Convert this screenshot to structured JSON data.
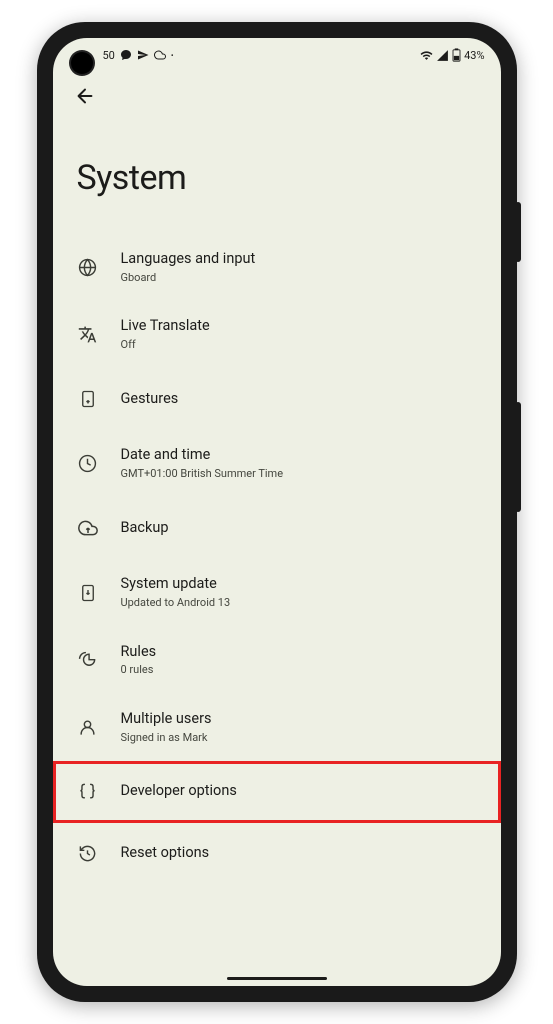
{
  "status_bar": {
    "time_fragment": "50",
    "battery_text": "43%"
  },
  "page": {
    "title": "System"
  },
  "items": [
    {
      "title": "Languages and input",
      "subtitle": "Gboard",
      "icon": "globe-icon"
    },
    {
      "title": "Live Translate",
      "subtitle": "Off",
      "icon": "translate-icon"
    },
    {
      "title": "Gestures",
      "subtitle": "",
      "icon": "gesture-icon"
    },
    {
      "title": "Date and time",
      "subtitle": "GMT+01:00 British Summer Time",
      "icon": "clock-icon"
    },
    {
      "title": "Backup",
      "subtitle": "",
      "icon": "cloud-icon"
    },
    {
      "title": "System update",
      "subtitle": "Updated to Android 13",
      "icon": "update-icon"
    },
    {
      "title": "Rules",
      "subtitle": "0 rules",
      "icon": "rules-icon"
    },
    {
      "title": "Multiple users",
      "subtitle": "Signed in as Mark",
      "icon": "person-icon"
    },
    {
      "title": "Developer options",
      "subtitle": "",
      "icon": "braces-icon",
      "highlighted": true
    },
    {
      "title": "Reset options",
      "subtitle": "",
      "icon": "reset-icon"
    }
  ]
}
